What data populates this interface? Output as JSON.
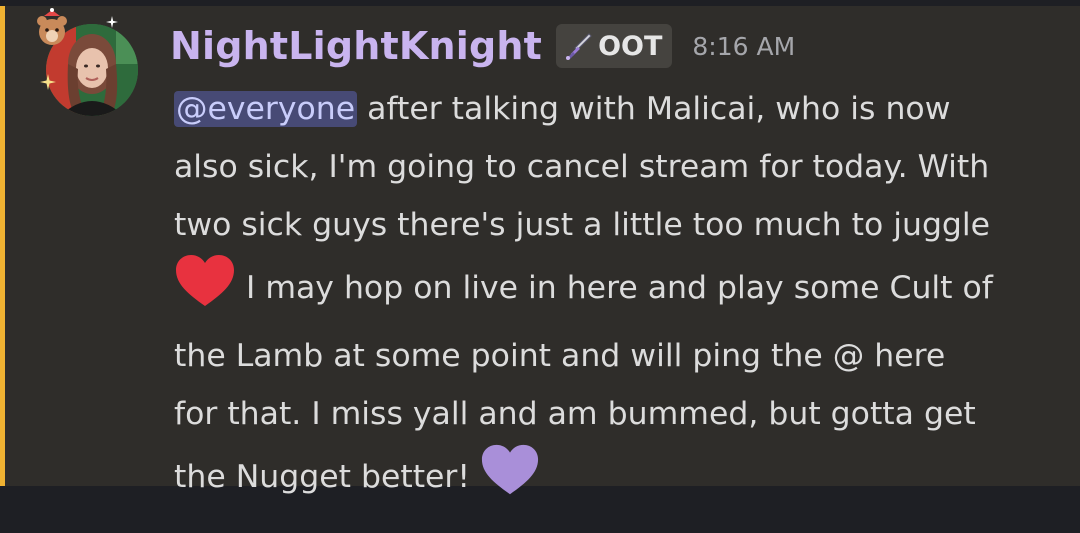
{
  "message": {
    "author": "NightLightKnight",
    "role_tag": {
      "icon": "sword-icon",
      "label": "OOT"
    },
    "timestamp": "8:16 AM",
    "mention": "@everyone",
    "lines": [
      " after talking with Malicai, who is now",
      "also sick, I'm going to cancel stream for today. With",
      "two sick guys there's just a little too much to juggle",
      " I may hop on live in here and play some Cult of",
      "the Lamb at some point and will ping the @ here",
      "for that. I miss yall and am bummed, but gotta get",
      "the Nugget better! "
    ],
    "emojis": [
      "red-heart-emoji",
      "purple-heart-emoji"
    ]
  },
  "colors": {
    "highlight_bar": "#f0b232",
    "username": "#c9b4ef",
    "mention_bg": "#474a75"
  }
}
